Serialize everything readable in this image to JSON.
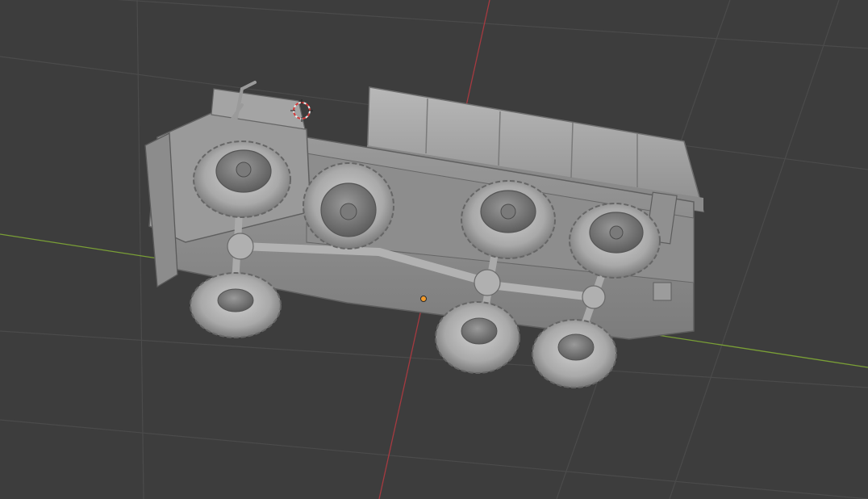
{
  "viewport": {
    "background": "#3d3d3d",
    "grid_color": "#4a4a4a",
    "x_axis_color": "#7fa23a",
    "y_axis_color": "#a8383d",
    "origin_color": "#f29a2a",
    "cursor_color": "#d23a3a"
  },
  "model": {
    "body_color": "#a6a6a6",
    "tire_color": "#b4b4b4",
    "shadow_color": "#6e6e6e"
  },
  "icons": {
    "cursor": "3d-cursor-icon",
    "origin": "object-origin-icon"
  }
}
